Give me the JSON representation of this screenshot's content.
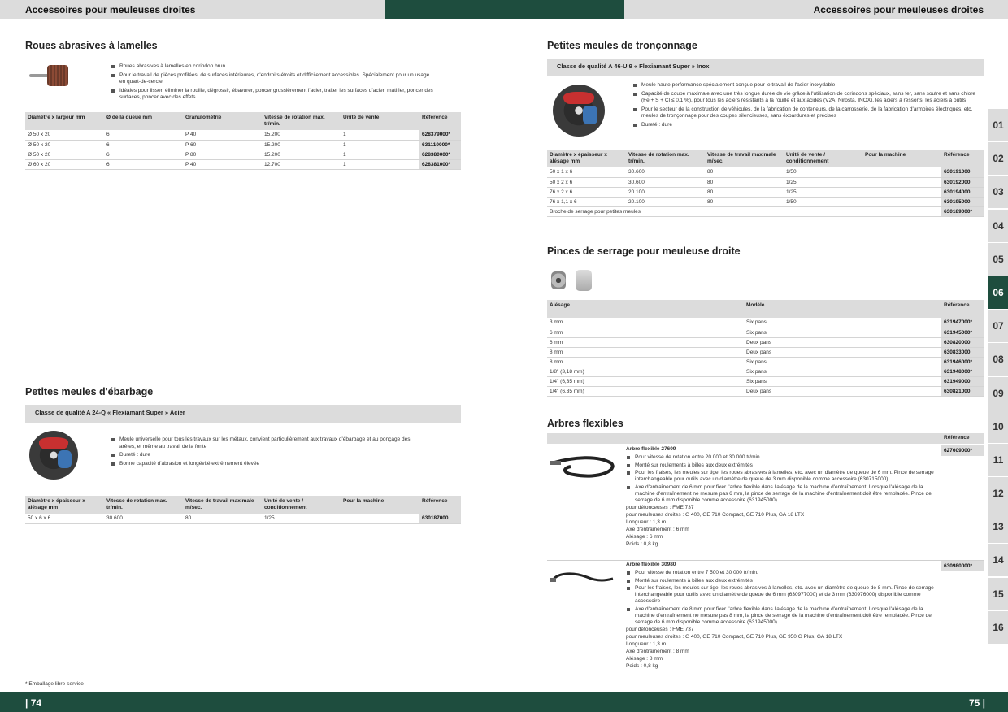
{
  "header": {
    "left": "Accessoires pour meuleuses droites",
    "right": "Accessoires pour meuleuses droites"
  },
  "footer": {
    "left_page": "| 74",
    "right_page": "75 |",
    "note": "* Emballage libre-service"
  },
  "tabs": [
    "01",
    "02",
    "03",
    "04",
    "05",
    "06",
    "07",
    "08",
    "09",
    "10",
    "11",
    "12",
    "13",
    "14",
    "15",
    "16"
  ],
  "active_tab": "06",
  "roues": {
    "title": "Roues abrasives à lamelles",
    "bullets": [
      "Roues abrasives à lamelles en corindon brun",
      "Pour le travail de pièces profilées, de surfaces intérieures, d'endroits étroits et difficilement accessibles. Spécialement pour un usage en quart-de-cercle.",
      "Idéales pour lisser, éliminer la rouille, dégrossir, ébavurer, poncer grossièrement l'acier, traiter les surfaces d'acier, matifier, poncer des surfaces, poncer avec des effets"
    ],
    "headers": [
      "Diamètre x largeur mm",
      "Ø de la queue mm",
      "Granulométrie",
      "Vitesse de rotation max. tr/min.",
      "Unité de vente",
      "Référence"
    ],
    "rows": [
      [
        "Ø 50 x 20",
        "6",
        "P 40",
        "15.200",
        "1",
        "628379000*"
      ],
      [
        "Ø 50 x 20",
        "6",
        "P 60",
        "15.200",
        "1",
        "631110000*"
      ],
      [
        "Ø 50 x 20",
        "6",
        "P 80",
        "15.200",
        "1",
        "628380000*"
      ],
      [
        "Ø 60 x 20",
        "6",
        "P 40",
        "12.700",
        "1",
        "628381000*"
      ]
    ]
  },
  "ebarbage": {
    "title": "Petites meules d'ébarbage",
    "band": "Classe de qualité A 24-Q « Flexiamant Super » Acier",
    "bullets": [
      "Meule universelle pour tous les travaux sur les métaux, convient particulièrement aux travaux d'ébarbage et au ponçage des arêtes, et même au travail de la fonte",
      "Dureté : dure",
      "Bonne capacité d'abrasion et longévité extrêmement élevée"
    ],
    "headers": [
      "Diamètre x épaisseur x alésage mm",
      "Vitesse de rotation max. tr/min.",
      "Vitesse de travail maximale m/sec.",
      "Unité de vente / conditionnement",
      "Pour la machine",
      "Référence"
    ],
    "rows": [
      [
        "50 x 6 x 6",
        "30.600",
        "80",
        "1/25",
        "",
        "630187000"
      ]
    ]
  },
  "tronconnage": {
    "title": "Petites meules de tronçonnage",
    "band": "Classe de qualité A 46-U 9 « Flexiamant Super » Inox",
    "bullets": [
      "Meule haute performance spécialement conçue pour le travail de l'acier inoxydable",
      "Capacité de coupe maximale avec une très longue durée de vie grâce à l'utilisation de corindons spéciaux, sans fer, sans soufre et sans chlore (Fe + S + Cl ≤ 0,1 %), pour tous les aciers résistants à la rouille et aux acides (V2A, Nirosta, INOX), les aciers à ressorts, les aciers à outils",
      "Pour le secteur de la construction de véhicules, de la fabrication de conteneurs, de la carrosserie, de la fabrication d'armoires électriques, etc. meules de tronçonnage pour des coupes silencieuses, sans éxbardures et précises",
      "Dureté : dure"
    ],
    "headers": [
      "Diamètre x épaisseur x alésage mm",
      "Vitesse de rotation max. tr/min.",
      "Vitesse de travail maximale m/sec.",
      "Unité de vente / conditionnement",
      "Pour la machine",
      "Référence"
    ],
    "rows": [
      [
        "50 x 1 x 6",
        "30.600",
        "80",
        "1/50",
        "",
        "630191000"
      ],
      [
        "50 x 2 x 6",
        "30.600",
        "80",
        "1/25",
        "",
        "630192000"
      ],
      [
        "76 x 2 x 6",
        "20.100",
        "80",
        "1/25",
        "",
        "630194000"
      ],
      [
        "76 x 1,1 x 6",
        "20.100",
        "80",
        "1/50",
        "",
        "630195000"
      ]
    ],
    "extra_label": "Broche de serrage pour petites meules",
    "extra_ref": "630189000*"
  },
  "pinces": {
    "title": "Pinces de serrage pour meuleuse droite",
    "headers": [
      "Alésage",
      "Modèle",
      "Référence"
    ],
    "rows": [
      [
        "3 mm",
        "Six pans",
        "631947000*"
      ],
      [
        "6 mm",
        "Six pans",
        "631945000*"
      ],
      [
        "6 mm",
        "Deux pans",
        "630820000"
      ],
      [
        "8 mm",
        "Deux pans",
        "630833000"
      ],
      [
        "8 mm",
        "Six pans",
        "631946000*"
      ],
      [
        "1/8\" (3,18 mm)",
        "Six pans",
        "631948000*"
      ],
      [
        "1/4\" (6,35 mm)",
        "Six pans",
        "631949000"
      ],
      [
        "1/4\" (6,35 mm)",
        "Deux pans",
        "630821000"
      ]
    ]
  },
  "arbres": {
    "title": "Arbres flexibles",
    "ref_header": "Référence",
    "items": [
      {
        "name": "Arbre flexible 27609",
        "ref": "627609000*",
        "bullets": [
          "Pour vitesse de rotation entre 20 000 et 30 000 tr/min.",
          "Monté sur roulements à billes aux deux extrémités",
          "Pour les fraises, les meules sur tige, les roues abrasives à lamelles, etc. avec un diamètre de queue de 6 mm. Pince de serrage interchangeable pour outils avec un diamètre de queue de 3 mm disponible comme accessoire (630715000)",
          "Axe d'entraînement de 6 mm pour fixer l'arbre flexible dans l'alésage de la machine d'entraînement. Lorsque l'alésage de la machine d'entraînement ne mesure pas 6 mm, la pince de serrage de la machine d'entraînement doit être remplacée. Pince de serrage de 6 mm disponible comme accessoire (631945000)"
        ],
        "lines": [
          "pour défonceuses : FME 737",
          "pour meuleuses droites : G 400, GE 710 Compact, GE 710 Plus, GA 18 LTX",
          "Longueur : 1,3 m",
          "Axe d'entraînement : 6 mm",
          "Alésage : 6 mm",
          "Poids : 0,8 kg"
        ]
      },
      {
        "name": "Arbre flexible 30980",
        "ref": "630980000*",
        "bullets": [
          "Pour vitesse de rotation entre 7 500 et 30 000 tr/min.",
          "Monté sur roulements à billes aux deux extrémités",
          "Pour les fraises, les meules sur tige, les roues abrasives à lamelles, etc. avec un diamètre de queue de 8 mm. Pince de serrage interchangeable pour outils avec un diamètre de queue de 6 mm (630977000) et de 3 mm (630976000) disponible comme accessoire",
          "Axe d'entraînement de 8 mm pour fixer l'arbre flexible dans l'alésage de la machine d'entraînement. Lorsque l'alésage de la machine d'entraînement ne mesure pas 8 mm, la pince de serrage de la machine d'entraînement doit être remplacée. Pince de serrage de 6 mm disponible comme accessoire (631945000)"
        ],
        "lines": [
          "pour défonceuses : FME 737",
          "pour meuleuses droites : G 400, GE 710 Compact, GE 710 Plus, GE 950 G Plus, GA 18 LTX",
          "Longueur : 1,3 m",
          "Axe d'entraînement : 8 mm",
          "Alésage : 8 mm",
          "Poids : 0,8 kg"
        ]
      }
    ]
  },
  "colors": {
    "brand_green": "#1e4d3e",
    "band_grey": "#dcdcdc"
  }
}
